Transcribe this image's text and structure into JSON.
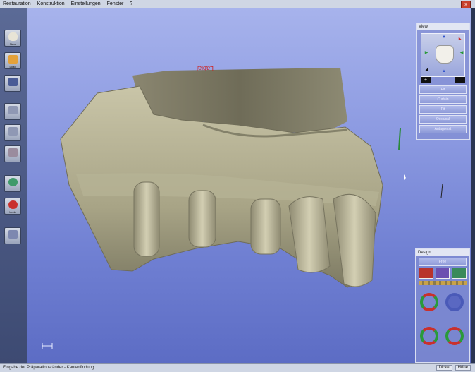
{
  "menu": [
    "Restauration",
    "Konstruktion",
    "Einstellungen",
    "Fenster",
    "?"
  ],
  "window_close": "x",
  "toolbar": {
    "items": [
      {
        "name": "new",
        "label": "New",
        "icon": "new-tooth-icon"
      },
      {
        "name": "load",
        "label": "Load",
        "icon": "folder-icon"
      },
      {
        "name": "save",
        "label": "",
        "icon": "save-icon"
      },
      {
        "name": "tool-4",
        "label": "",
        "icon": "tooth-icon"
      },
      {
        "name": "tool-5",
        "label": "",
        "icon": "tooth-icon"
      },
      {
        "name": "tool-6",
        "label": "",
        "icon": "tooth-icon"
      },
      {
        "name": "next",
        "label": "",
        "icon": "arrow-right-icon"
      },
      {
        "name": "undo",
        "label": "Undo",
        "icon": "arrow-left-icon"
      },
      {
        "name": "tool-9",
        "label": "",
        "icon": "cube-icon"
      }
    ]
  },
  "model_label": "Labial",
  "view_panel": {
    "title": "View",
    "zoom_in": "+",
    "zoom_out": "–",
    "buttons": [
      "Fit",
      "Curtain",
      "Fit",
      "Occlusal",
      "Antagonist"
    ]
  },
  "design_panel": {
    "title": "Design",
    "top_button": "Free"
  },
  "status": {
    "hint": "Eingabe der Präparationsränder - Kantenfindung",
    "right": [
      "Dicke",
      "Höhe"
    ]
  },
  "colors": {
    "viewport_top": "#a7b3ec",
    "viewport_bottom": "#5c6cc4",
    "model": "#a7a48a"
  }
}
